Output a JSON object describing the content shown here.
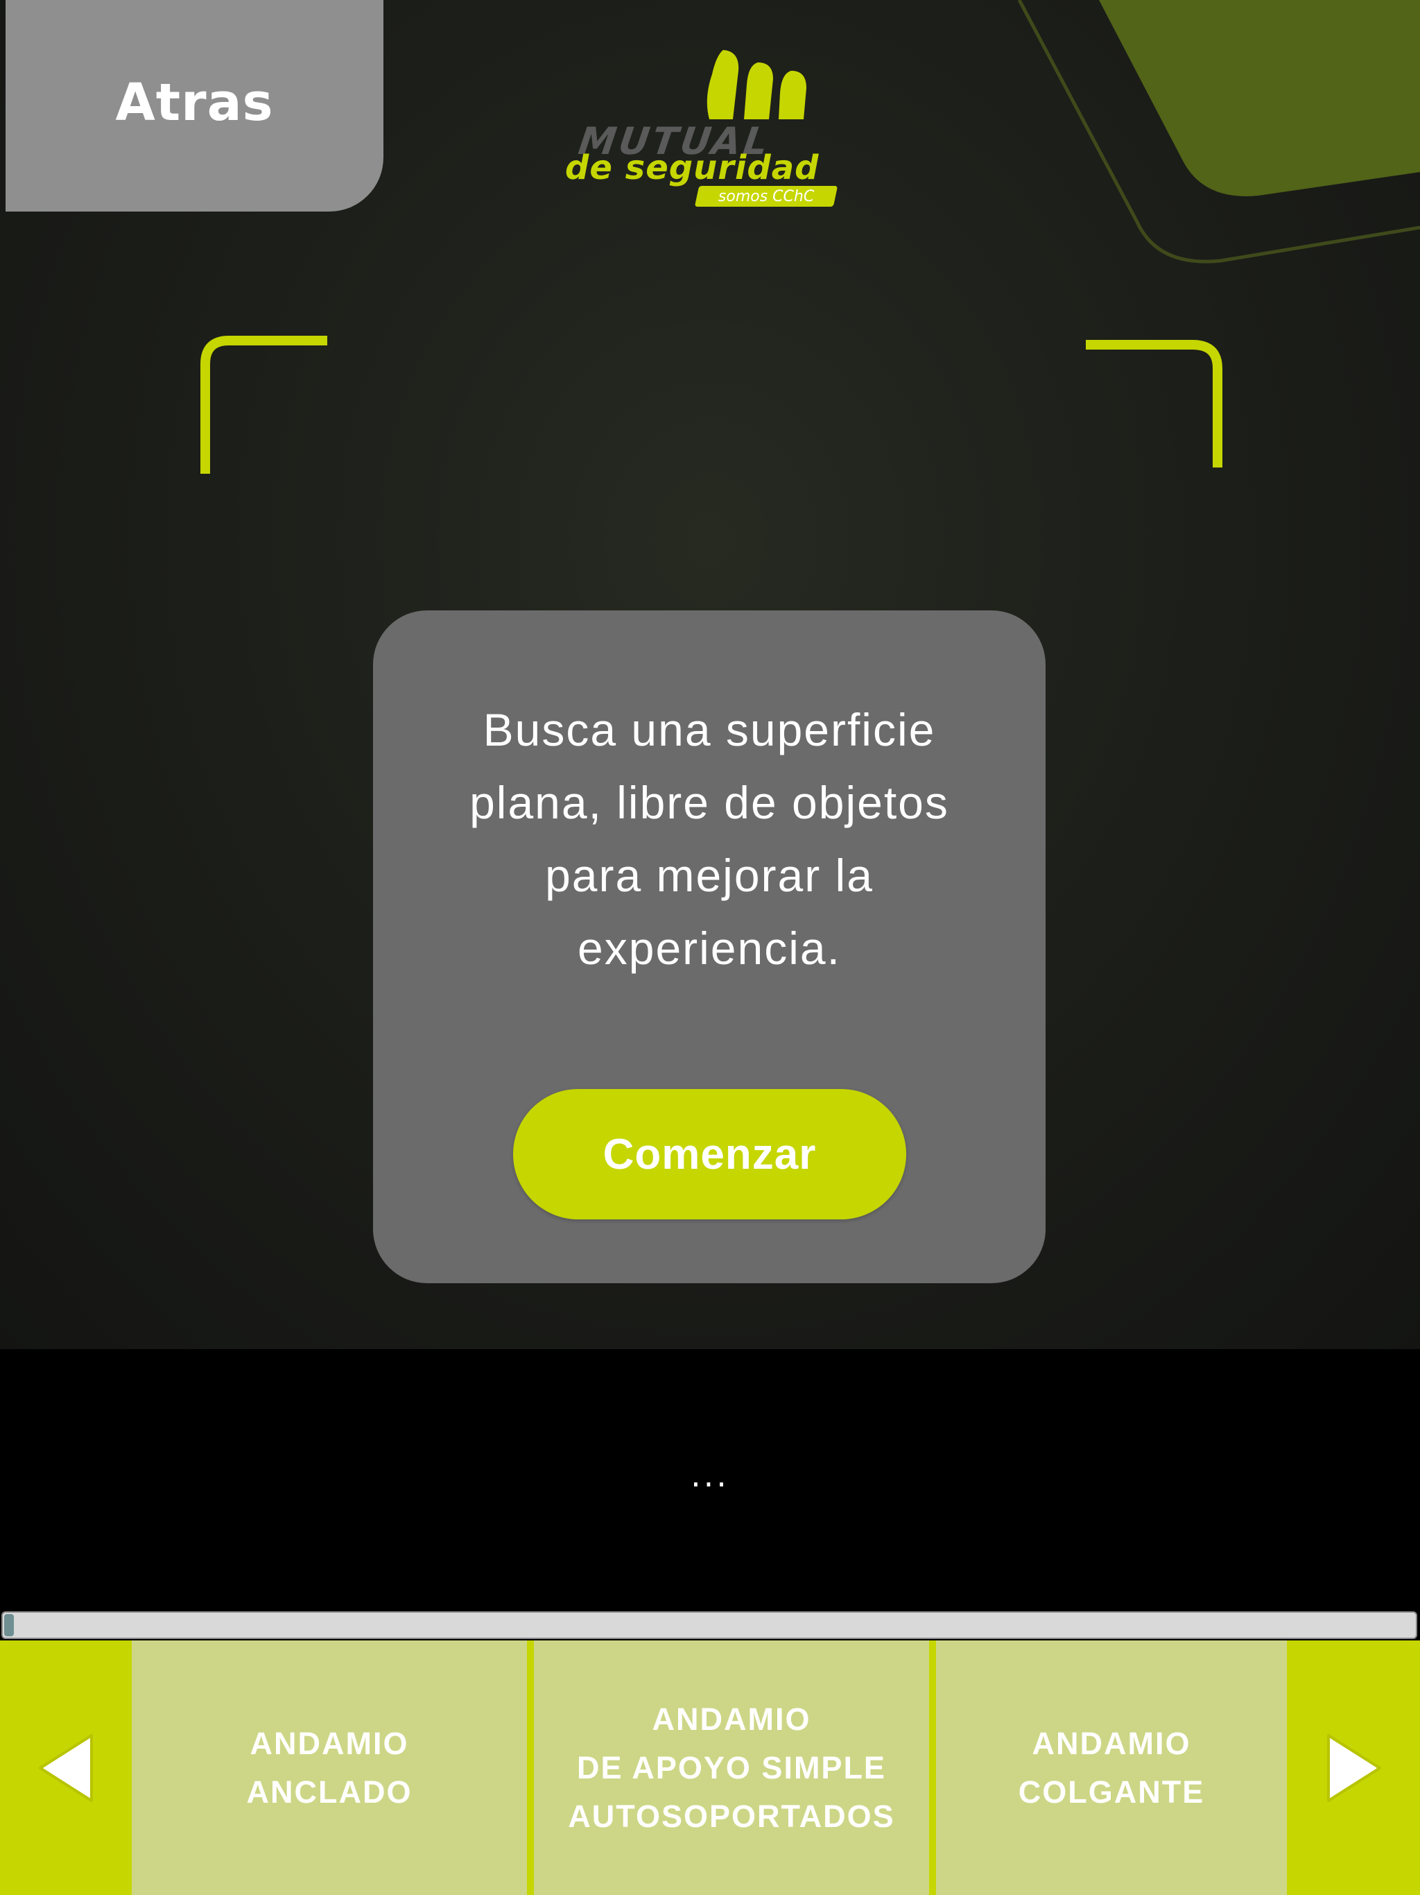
{
  "header": {
    "back_label": "Atras"
  },
  "logo": {
    "line1": "MUTUAL",
    "line2": "de seguridad",
    "tagline": "somos CChC"
  },
  "dialog": {
    "message": "Busca una superficie plana, libre de objetos para mejorar la experiencia.",
    "start_label": "Comenzar"
  },
  "status": {
    "text": "..."
  },
  "progress": {
    "value": 0
  },
  "nav": {
    "prev_icon": "triangle-left-icon",
    "next_icon": "triangle-right-icon",
    "items": [
      {
        "label": "ANDAMIO\nANCLADO"
      },
      {
        "label": "ANDAMIO\nDE APOYO SIMPLE\nAUTOSOPORTADOS"
      },
      {
        "label": "ANDAMIO\nCOLGANTE"
      }
    ]
  },
  "colors": {
    "accent": "#c5d600",
    "card_bg": "#cdd686",
    "dialog_bg": "#6b6b6b",
    "back_bg": "#8f8f8f"
  }
}
